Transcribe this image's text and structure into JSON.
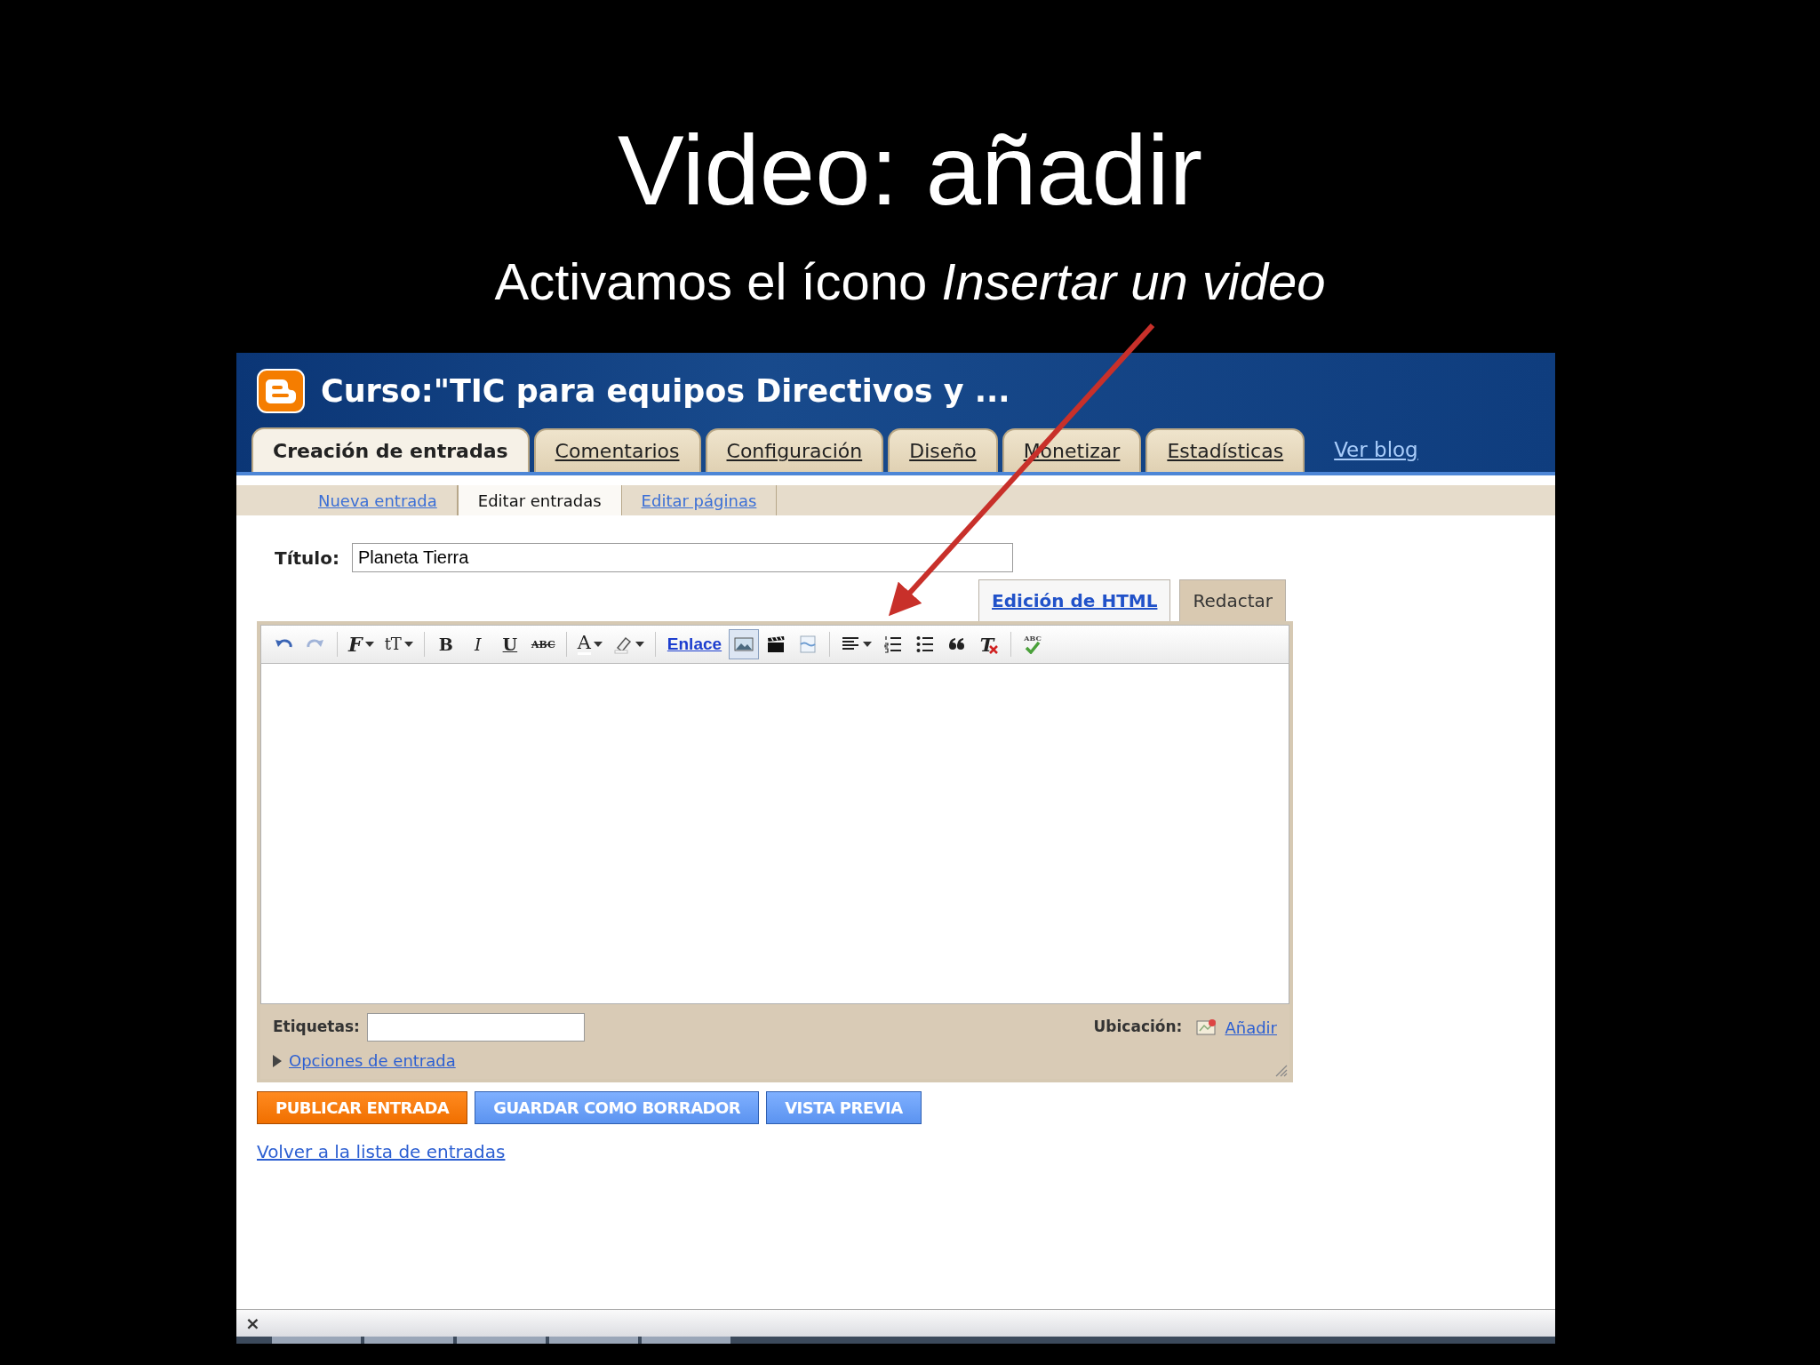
{
  "slide": {
    "title": "Video: añadir",
    "subtitle": "Activamos el ícono *Insertar un video*"
  },
  "blog": {
    "title": "Curso:\"TIC para equipos Directivos y ...",
    "tabs": [
      {
        "label": "Creación de entradas",
        "selected": true
      },
      {
        "label": "Comentarios",
        "selected": false
      },
      {
        "label": "Configuración",
        "selected": false
      },
      {
        "label": "Diseño",
        "selected": false
      },
      {
        "label": "Monetizar",
        "selected": false
      },
      {
        "label": "Estadísticas",
        "selected": false
      }
    ],
    "view_link": "Ver blog",
    "subtabs": [
      {
        "label": "Nueva entrada",
        "selected": false
      },
      {
        "label": "Editar entradas",
        "selected": true
      },
      {
        "label": "Editar páginas",
        "selected": false
      }
    ]
  },
  "editor": {
    "title_label": "Título:",
    "title_value": "Planeta Tierra",
    "modes": [
      {
        "label": "Edición de HTML",
        "selected": false
      },
      {
        "label": "Redactar",
        "selected": true
      }
    ],
    "toolbar": [
      {
        "kind": "icon",
        "disabled": false,
        "active": false,
        "has_menu": false
      },
      {
        "kind": "icon",
        "disabled": true,
        "active": false,
        "has_menu": false
      },
      {
        "kind": "separator"
      },
      {
        "kind": "font",
        "text": "F",
        "disabled": false,
        "active": false,
        "has_menu": true
      },
      {
        "kind": "size",
        "text": "tT",
        "disabled": false,
        "active": false,
        "has_menu": true
      },
      {
        "kind": "separator"
      },
      {
        "kind": "bold",
        "text": "B",
        "disabled": false,
        "active": false,
        "has_menu": false
      },
      {
        "kind": "italic",
        "text": "I",
        "disabled": false,
        "active": false,
        "has_menu": false
      },
      {
        "kind": "underline",
        "text": "U",
        "disabled": false,
        "active": false,
        "has_menu": false
      },
      {
        "kind": "strike",
        "text": "ABC",
        "disabled": false,
        "active": false,
        "has_menu": false
      },
      {
        "kind": "separator"
      },
      {
        "kind": "color",
        "text": "A",
        "disabled": false,
        "active": false,
        "has_menu": true
      },
      {
        "kind": "icon",
        "disabled": false,
        "active": false,
        "has_menu": true
      },
      {
        "kind": "separator"
      },
      {
        "kind": "link",
        "text": "Enlace"
      },
      {
        "kind": "icon",
        "disabled": false,
        "active": true,
        "has_menu": false
      },
      {
        "kind": "icon",
        "disabled": false,
        "active": false,
        "has_menu": false
      },
      {
        "kind": "icon",
        "disabled": false,
        "active": false,
        "has_menu": false
      },
      {
        "kind": "separator"
      },
      {
        "kind": "icon",
        "disabled": false,
        "active": false,
        "has_menu": true
      },
      {
        "kind": "icon",
        "disabled": false,
        "active": false,
        "has_menu": false
      },
      {
        "kind": "icon",
        "disabled": false,
        "active": false,
        "has_menu": false
      },
      {
        "kind": "icon",
        "disabled": false,
        "active": false,
        "has_menu": false
      },
      {
        "kind": "remove",
        "text": "T",
        "disabled": false,
        "active": false,
        "has_menu": false
      },
      {
        "kind": "separator"
      },
      {
        "kind": "spell",
        "text": "ABC",
        "disabled": false,
        "active": false,
        "has_menu": false
      }
    ],
    "labels_label": "Etiquetas:",
    "location_label": "Ubicación:",
    "location_link": "Añadir",
    "options_link": "Opciones de entrada"
  },
  "buttons": [
    {
      "label": "PUBLICAR ENTRADA",
      "kind": "primary"
    },
    {
      "label": "GUARDAR COMO BORRADOR",
      "kind": "secondary"
    },
    {
      "label": "VISTA PREVIA",
      "kind": "secondary"
    }
  ],
  "back_link": "Volver a la lista de entradas",
  "find_bar": {
    "close": "×"
  }
}
